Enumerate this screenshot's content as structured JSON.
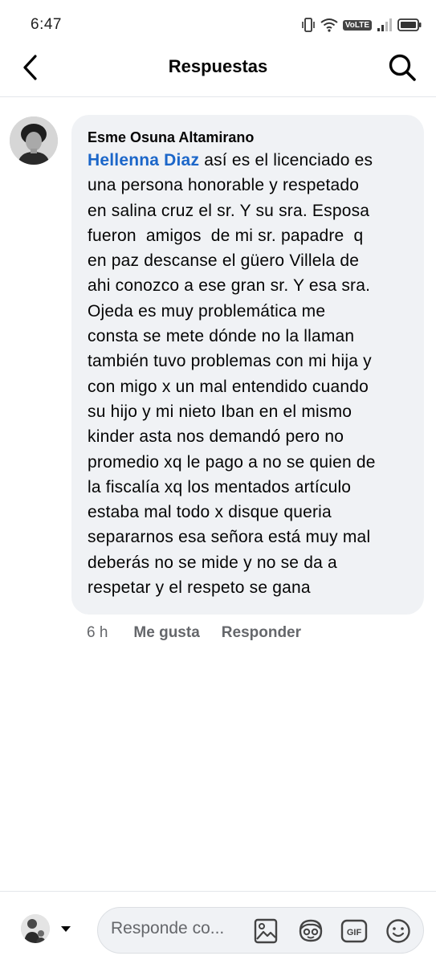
{
  "status_bar": {
    "time": "6:47",
    "network_badge": "VoLTE"
  },
  "header": {
    "title": "Respuestas",
    "icons": [
      "back-arrow-icon",
      "search-icon"
    ]
  },
  "comment": {
    "author": "Esme Osuna Altamirano",
    "mention": "Hellenna Diaz",
    "lines": [
      " así es el licenciado es",
      "una persona honorable y respetado",
      "en salina cruz el sr. Y su sra. Esposa",
      "fueron  amigos  de mi sr. papadre  q",
      "en paz descanse el güero Villela de",
      "ahi conozco a ese gran sr. Y esa sra.",
      "Ojeda es muy problemática me",
      "consta se mete dónde no la llaman",
      "también tuvo problemas con mi hija y",
      "con migo x un mal entendido cuando",
      "su hijo y mi nieto Iban en el mismo",
      "kinder asta nos demandó pero no",
      "promedio xq le pago a no se quien de",
      "la fiscalía xq los mentados artículo",
      "estaba mal todo x disque queria",
      "separarnos esa señora está muy mal",
      "deberás no se mide y no se da a",
      "respetar y el respeto se gana"
    ],
    "time": "6 h",
    "like_label": "Me gusta",
    "reply_label": "Responder"
  },
  "footer": {
    "placeholder": "Responde co...",
    "icons": [
      "image-icon",
      "avatar-sticker-icon",
      "gif-icon",
      "emoji-icon"
    ]
  },
  "colors": {
    "mention": "#1b66c9",
    "bubble": "#f0f2f5",
    "muted": "#65676b"
  }
}
